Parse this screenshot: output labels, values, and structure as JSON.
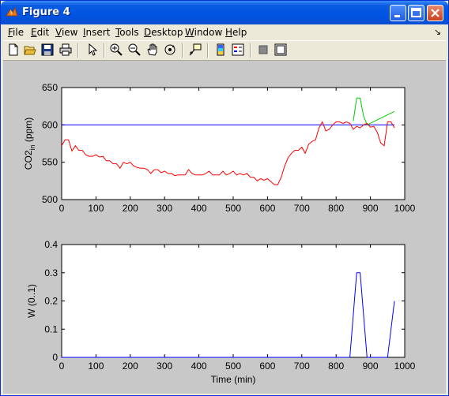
{
  "window": {
    "title": "Figure 4",
    "colors": {
      "titlebar": "#0054e3",
      "figure_bg": "#c8c8c8"
    }
  },
  "menu": {
    "items": [
      {
        "label": "File"
      },
      {
        "label": "Edit"
      },
      {
        "label": "View"
      },
      {
        "label": "Insert"
      },
      {
        "label": "Tools"
      },
      {
        "label": "Desktop"
      },
      {
        "label": "Window"
      },
      {
        "label": "Help"
      }
    ],
    "dock_arrow": "↘"
  },
  "toolbar": {
    "icons": [
      "new-file-icon",
      "open-file-icon",
      "save-icon",
      "print-icon",
      "pointer-icon",
      "zoom-in-icon",
      "zoom-out-icon",
      "pan-hand-icon",
      "rotate-3d-icon",
      "data-cursor-icon",
      "colorbar-icon",
      "legend-icon",
      "hide-plot-tools-icon",
      "show-plot-tools-icon"
    ]
  },
  "chart_data": [
    {
      "type": "line",
      "xlabel": "",
      "ylabel_main": "CO2",
      "ylabel_sub": "in",
      "ylabel_unit": " (ppm)",
      "xlim": [
        0,
        1000
      ],
      "ylim": [
        500,
        650
      ],
      "xticks": [
        "0",
        "100",
        "200",
        "300",
        "400",
        "500",
        "600",
        "700",
        "800",
        "900",
        "1000"
      ],
      "yticks": [
        "500",
        "550",
        "600",
        "650"
      ],
      "grid": false,
      "series": [
        {
          "name": "",
          "color": "#0000ff",
          "x": [
            0,
            970
          ],
          "y": [
            600,
            600
          ]
        },
        {
          "name": "",
          "color": "#00cc00",
          "x": [
            850,
            860,
            870,
            880,
            890,
            970
          ],
          "y": [
            605,
            636,
            636,
            612,
            600,
            618
          ]
        },
        {
          "name": "",
          "color": "#ff0000",
          "x": [
            0,
            10,
            20,
            30,
            40,
            50,
            60,
            70,
            80,
            90,
            100,
            110,
            120,
            130,
            140,
            150,
            160,
            170,
            180,
            190,
            200,
            210,
            220,
            230,
            240,
            250,
            260,
            270,
            280,
            290,
            300,
            310,
            320,
            330,
            340,
            350,
            360,
            370,
            380,
            390,
            400,
            410,
            420,
            430,
            440,
            450,
            460,
            470,
            480,
            490,
            500,
            510,
            520,
            530,
            540,
            550,
            560,
            570,
            580,
            590,
            600,
            610,
            620,
            630,
            640,
            650,
            660,
            670,
            680,
            690,
            700,
            710,
            720,
            730,
            740,
            750,
            760,
            770,
            780,
            790,
            800,
            810,
            820,
            830,
            840,
            850,
            860,
            870,
            880,
            890,
            900,
            910,
            920,
            930,
            940,
            950,
            960,
            970
          ],
          "y": [
            572,
            580,
            580,
            565,
            572,
            566,
            566,
            560,
            558,
            558,
            560,
            557,
            558,
            552,
            552,
            548,
            548,
            542,
            550,
            548,
            550,
            545,
            543,
            542,
            542,
            540,
            535,
            540,
            540,
            536,
            538,
            535,
            535,
            532,
            533,
            533,
            533,
            540,
            535,
            533,
            533,
            533,
            535,
            538,
            533,
            533,
            533,
            538,
            533,
            535,
            538,
            533,
            535,
            533,
            535,
            530,
            530,
            525,
            528,
            526,
            528,
            524,
            520,
            520,
            530,
            545,
            556,
            562,
            566,
            566,
            570,
            562,
            574,
            578,
            580,
            596,
            604,
            592,
            594,
            600,
            604,
            604,
            602,
            604,
            602,
            594,
            598,
            596,
            600,
            602,
            597,
            598,
            590,
            576,
            572,
            604,
            604,
            596
          ]
        }
      ]
    },
    {
      "type": "line",
      "xlabel": "Time (min)",
      "ylabel": "W (0..1)",
      "xlim": [
        0,
        1000
      ],
      "ylim": [
        0,
        0.4
      ],
      "xticks": [
        "0",
        "100",
        "200",
        "300",
        "400",
        "500",
        "600",
        "700",
        "800",
        "900",
        "1000"
      ],
      "yticks": [
        "0",
        "0.1",
        "0.2",
        "0.3",
        "0.4"
      ],
      "grid": false,
      "series": [
        {
          "name": "",
          "color": "#0000ff",
          "x": [
            0,
            840,
            860,
            870,
            890,
            900,
            950,
            970
          ],
          "y": [
            0,
            0,
            0.3,
            0.3,
            0,
            0,
            0,
            0.2
          ]
        }
      ]
    }
  ]
}
